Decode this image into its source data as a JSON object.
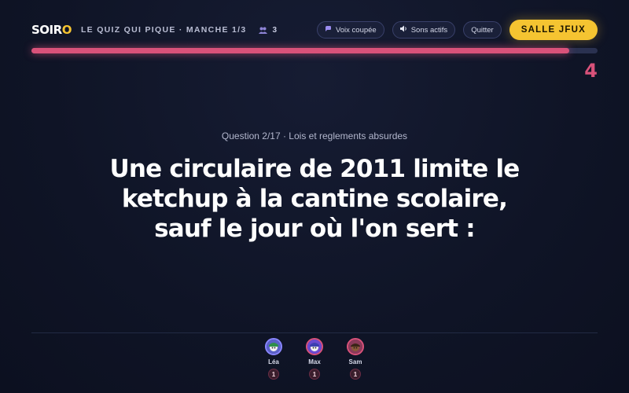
{
  "header": {
    "logo": {
      "text_main": "SOIR",
      "text_accent": "O"
    },
    "subtitle": "LE QUIZ QUI PIQUE · MANCHE 1/3",
    "player_count": "3",
    "buttons": {
      "voice_label": "Voix coupée",
      "sound_label": "Sons actifs",
      "quit_label": "Quitter",
      "room_label": "SALLE JFUX"
    }
  },
  "timer": {
    "seconds_left": "4",
    "progress": 0.95
  },
  "question": {
    "meta": "Question 2/17 · Lois et reglements absurdes",
    "lines": [
      "Une circulaire de 2011 limite le",
      "ketchup à la cantine scolaire,",
      "sauf le jour où l'on sert :"
    ]
  },
  "players": [
    {
      "name": "Léa",
      "score": "1",
      "ring_color": "#8a86ff"
    },
    {
      "name": "Max",
      "score": "1",
      "ring_color": "#d9527a"
    },
    {
      "name": "Sam",
      "score": "1",
      "ring_color": "#d9527a"
    }
  ],
  "colors": {
    "background": "#0f1426",
    "accent_pink": "#d9527a",
    "accent_yellow": "#f5c431"
  }
}
